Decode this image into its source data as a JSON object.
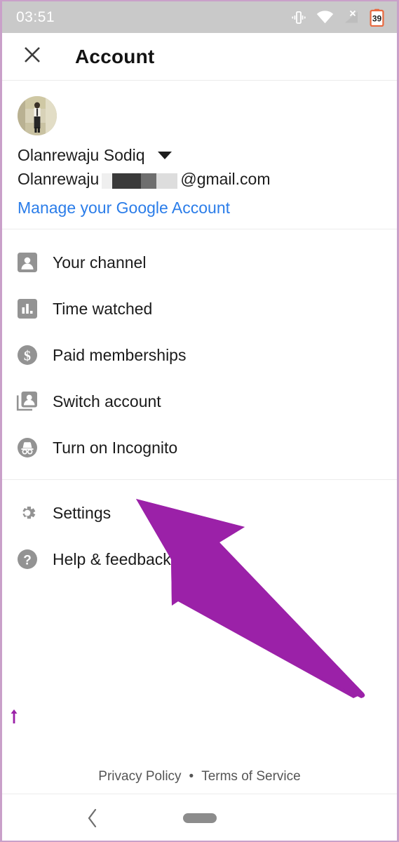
{
  "statusbar": {
    "time": "03:51",
    "icons": [
      {
        "name": "vibrate-icon",
        "label": "vibrate"
      },
      {
        "name": "wifi-icon",
        "label": "wifi-full"
      },
      {
        "name": "cellular-no-sim-icon",
        "label": "signal-x"
      },
      {
        "name": "battery-icon",
        "label": "battery",
        "value": "39"
      }
    ],
    "background_color": "#c9c9c9",
    "battery_color": "#e8693f"
  },
  "appbar": {
    "close_icon": "close-icon",
    "title": "Account"
  },
  "account": {
    "avatar_alt": "profile-photo",
    "name": "Olanrewaju Sodiq",
    "caret_icon": "chevron-down-icon",
    "email_prefix": "Olanrewaju",
    "email_redacted": "██████",
    "email_suffix": "@gmail.com",
    "manage_link": "Manage your Google Account",
    "link_color": "#2b7de9"
  },
  "menu": {
    "primary": [
      {
        "icon": "person-card-icon",
        "label": "Your channel"
      },
      {
        "icon": "bar-chart-icon",
        "label": "Time watched"
      },
      {
        "icon": "dollar-circle-icon",
        "label": "Paid memberships"
      },
      {
        "icon": "switch-account-icon",
        "label": "Switch account"
      },
      {
        "icon": "incognito-icon",
        "label": "Turn on Incognito"
      }
    ],
    "secondary": [
      {
        "icon": "gear-icon",
        "label": "Settings"
      },
      {
        "icon": "help-circle-icon",
        "label": "Help & feedback"
      }
    ]
  },
  "annotation": {
    "arrow_color": "#9b21a8",
    "arrow_name": "highlight-arrow-pointing-to-settings",
    "mini_arrow_name": "small-arrow-artifact"
  },
  "footer": {
    "privacy": "Privacy Policy",
    "separator": "•",
    "terms": "Terms of Service"
  },
  "navbar": {
    "back_icon": "back-chevron-icon",
    "home_pill": "home-gesture-pill"
  }
}
